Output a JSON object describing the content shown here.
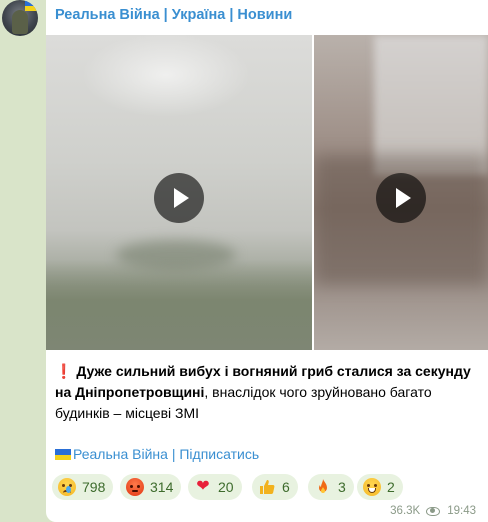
{
  "channel": {
    "title": "Реальна Війна | Україна | Новини"
  },
  "media": [
    {
      "kind": "video",
      "play_icon": "play-icon"
    },
    {
      "kind": "video",
      "play_icon": "play-icon"
    }
  ],
  "message": {
    "exclamation": "❗",
    "headline": "Дуже сильний вибух і вогняний гриб сталися за секунду на Дніпропетровщині",
    "rest": ", внаслідок чого зруйновано багато будинків – місцеві ЗМІ",
    "subscribe_link": "Реальна Війна | Підписатись"
  },
  "reactions": [
    {
      "emoji": "crying-face",
      "count": "798"
    },
    {
      "emoji": "angry-face",
      "count": "314"
    },
    {
      "emoji": "red-heart",
      "count": "20"
    },
    {
      "emoji": "thumbs-up",
      "count": "6"
    },
    {
      "emoji": "fire",
      "count": "3"
    },
    {
      "emoji": "grinning-face",
      "count": "2"
    }
  ],
  "meta": {
    "views": "36.3K",
    "time": "19:43"
  },
  "colors": {
    "chat_background": "#d9e4c9",
    "link": "#3a8fd1",
    "reaction_bg": "#e8f2e0",
    "reaction_text": "#3d6b2c",
    "meta_text": "#8b9a88"
  }
}
